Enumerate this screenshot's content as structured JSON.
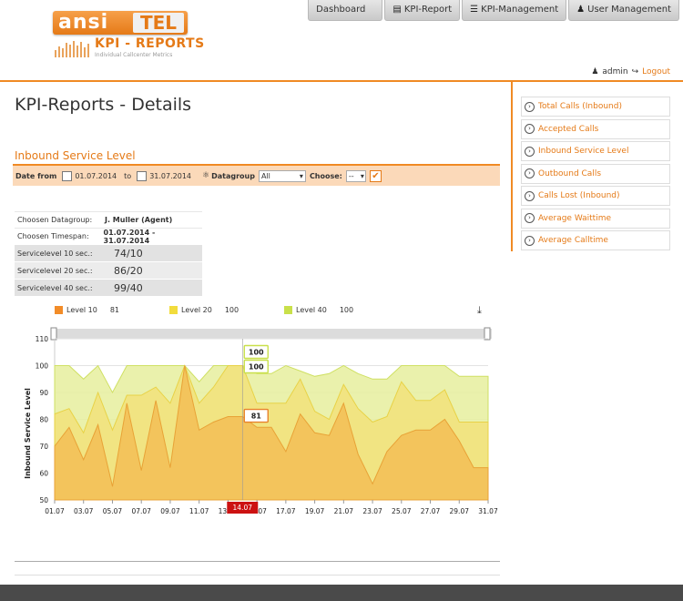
{
  "logo": {
    "ansi": "ansi",
    "tel": "TEL",
    "title": "KPI - REPORTS",
    "subtitle": "Individual Callcenter Metrics"
  },
  "nav": {
    "items": [
      {
        "label": "Dashboard",
        "icon": ""
      },
      {
        "label": "KPI-Report",
        "icon": "chart-icon"
      },
      {
        "label": "KPI-Management",
        "icon": "list-icon"
      },
      {
        "label": "User Management",
        "icon": "user-icon"
      }
    ]
  },
  "user": {
    "name": "admin",
    "logout": "Logout"
  },
  "page": {
    "title": "KPI-Reports - Details",
    "section": "Inbound Service Level"
  },
  "sidebar": {
    "items": [
      {
        "label": "Total Calls (Inbound)"
      },
      {
        "label": "Accepted Calls"
      },
      {
        "label": "Inbound Service Level"
      },
      {
        "label": "Outbound Calls"
      },
      {
        "label": "Calls Lost (Inbound)"
      },
      {
        "label": "Average Waittime"
      },
      {
        "label": "Average Calltime"
      }
    ]
  },
  "filter": {
    "date_from_label": "Date from",
    "date_from": "01.07.2014",
    "to_label": "to",
    "date_to": "31.07.2014",
    "datagroup_label": "Datagroup",
    "datagroup_value": "All",
    "choose_label": "Choose:",
    "choose_value": "--"
  },
  "info": {
    "datagroup_label": "Choosen Datagroup:",
    "datagroup_value": "J. Muller (Agent)",
    "timespan_label": "Choosen Timespan:",
    "timespan_value": "01.07.2014 - 31.07.2014",
    "levels": [
      {
        "label": "Servicelevel 10 sec.:",
        "value": "74/10"
      },
      {
        "label": "Servicelevel 20 sec.:",
        "value": "86/20"
      },
      {
        "label": "Servicelevel 40 sec.:",
        "value": "99/40"
      }
    ]
  },
  "colors": {
    "accent": "#f08a24",
    "level10": "#f28c28",
    "level20": "#f2dc3c",
    "level40": "#c9e04a"
  },
  "chart_data": {
    "type": "area",
    "ylabel": "Inbound Service Level",
    "ylim": [
      50,
      110
    ],
    "yticks": [
      "50",
      "60",
      "70",
      "80",
      "90",
      "100",
      "110"
    ],
    "x": [
      "01.07",
      "02.07",
      "03.07",
      "04.07",
      "05.07",
      "06.07",
      "07.07",
      "08.07",
      "09.07",
      "10.07",
      "11.07",
      "12.07",
      "13.07",
      "14.07",
      "15.07",
      "16.07",
      "17.07",
      "18.07",
      "19.07",
      "20.07",
      "21.07",
      "22.07",
      "23.07",
      "24.07",
      "25.07",
      "26.07",
      "27.07",
      "28.07",
      "29.07",
      "30.07",
      "31.07"
    ],
    "xtick_labels": [
      "01.07",
      "03.07",
      "05.07",
      "07.07",
      "09.07",
      "11.07",
      "13.07",
      "15.07",
      "17.07",
      "19.07",
      "21.07",
      "23.07",
      "25.07",
      "27.07",
      "29.07",
      "31.07"
    ],
    "series": [
      {
        "name": "Level 10",
        "legend_value": "81",
        "values": [
          70,
          77,
          65,
          78,
          55,
          86,
          61,
          87,
          62,
          100,
          76,
          79,
          81,
          81,
          77,
          77,
          68,
          82,
          75,
          74,
          86,
          67,
          56,
          68,
          74,
          76,
          76,
          80,
          72,
          62,
          62
        ]
      },
      {
        "name": "Level 20",
        "legend_value": "100",
        "values": [
          82,
          84,
          75,
          90,
          76,
          89,
          89,
          92,
          86,
          100,
          86,
          92,
          100,
          100,
          86,
          86,
          86,
          95,
          83,
          80,
          93,
          84,
          79,
          81,
          94,
          87,
          87,
          91,
          79,
          79,
          79
        ]
      },
      {
        "name": "Level 40",
        "legend_value": "100",
        "values": [
          100,
          100,
          95,
          100,
          90,
          100,
          100,
          100,
          100,
          100,
          94,
          100,
          100,
          100,
          97,
          97,
          100,
          98,
          96,
          97,
          100,
          97,
          95,
          95,
          100,
          100,
          100,
          100,
          96,
          96,
          96
        ]
      }
    ],
    "crosshair_x": "14.07",
    "tooltip_values": [
      "100",
      "100",
      "81"
    ],
    "legend_position": "top"
  }
}
